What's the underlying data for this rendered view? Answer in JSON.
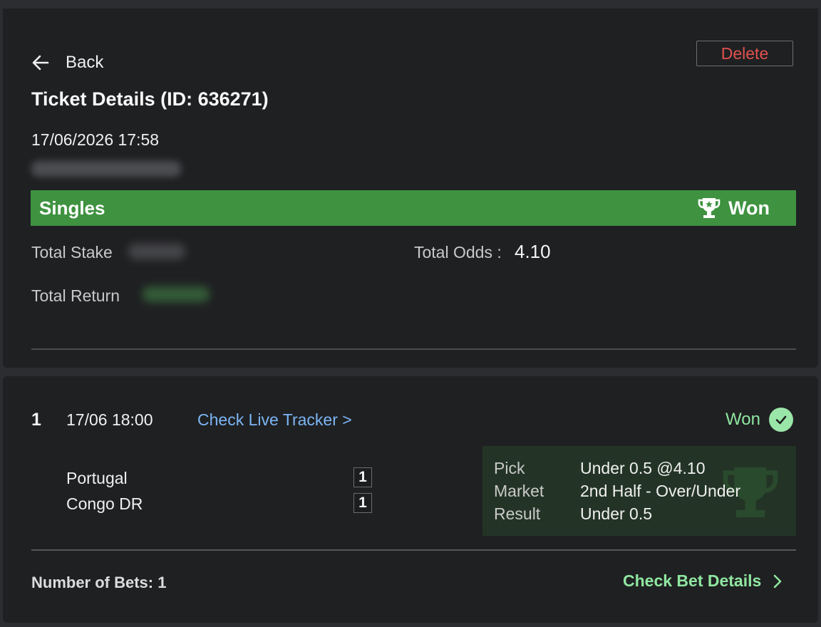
{
  "header": {
    "back_label": "Back",
    "delete_label": "Delete",
    "title": "Ticket Details (ID: 636271)",
    "datetime": "17/06/2026 17:58"
  },
  "banner": {
    "type": "Singles",
    "status": "Won",
    "status_icon": "trophy-icon",
    "color": "#3f9240"
  },
  "summary": {
    "stake_label": "Total Stake",
    "odds_label": "Total Odds :",
    "odds_value": "4.10",
    "return_label": "Total Return"
  },
  "bet": {
    "index": "1",
    "date": "17/06 18:00",
    "tracker_link": "Check Live Tracker >",
    "status": "Won",
    "status_icon": "check-circle-icon",
    "teams": [
      {
        "name": "Portugal",
        "score": "1"
      },
      {
        "name": "Congo DR",
        "score": "1"
      }
    ],
    "details": {
      "pick_label": "Pick",
      "pick_value": "Under 0.5 @4.10",
      "market_label": "Market",
      "market_value": "2nd Half - Over/Under",
      "result_label": "Result",
      "result_value": "Under 0.5"
    }
  },
  "footer": {
    "bets_count": "Number of Bets: 1",
    "details_link": "Check Bet Details",
    "link_color": "#8fe6a0"
  }
}
